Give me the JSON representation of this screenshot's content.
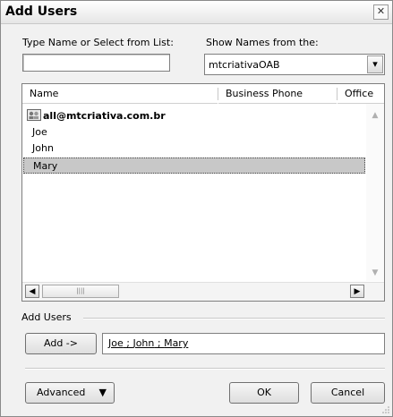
{
  "dialog": {
    "title": "Add Users",
    "close_label": "✕"
  },
  "search": {
    "label": "Type Name or Select from List:",
    "value": ""
  },
  "source": {
    "label": "Show Names from the:",
    "selected": "mtcriativaOAB",
    "arrow": "▾"
  },
  "list": {
    "columns": [
      "Name",
      "Business Phone",
      "Office"
    ],
    "rows": [
      {
        "label": "all@mtcriativa.com.br",
        "icon": "group-icon",
        "selected": false
      },
      {
        "label": "Joe",
        "selected": false
      },
      {
        "label": "John",
        "selected": false
      },
      {
        "label": "Mary",
        "selected": true
      }
    ],
    "scroll_up": "▲",
    "scroll_down": "▼",
    "scroll_left": "◀",
    "scroll_right": "▶",
    "thumb_grip": "||||"
  },
  "add_users": {
    "section_label": "Add Users",
    "add_button": "Add ->",
    "recipients": [
      "Joe",
      "John",
      "Mary"
    ],
    "separator": " ; "
  },
  "footer": {
    "advanced_label": "Advanced",
    "advanced_arrow": "▼",
    "ok_label": "OK",
    "cancel_label": "Cancel"
  },
  "colors": {
    "selection": "#c8c8c8",
    "background": "#f1f1f1"
  }
}
